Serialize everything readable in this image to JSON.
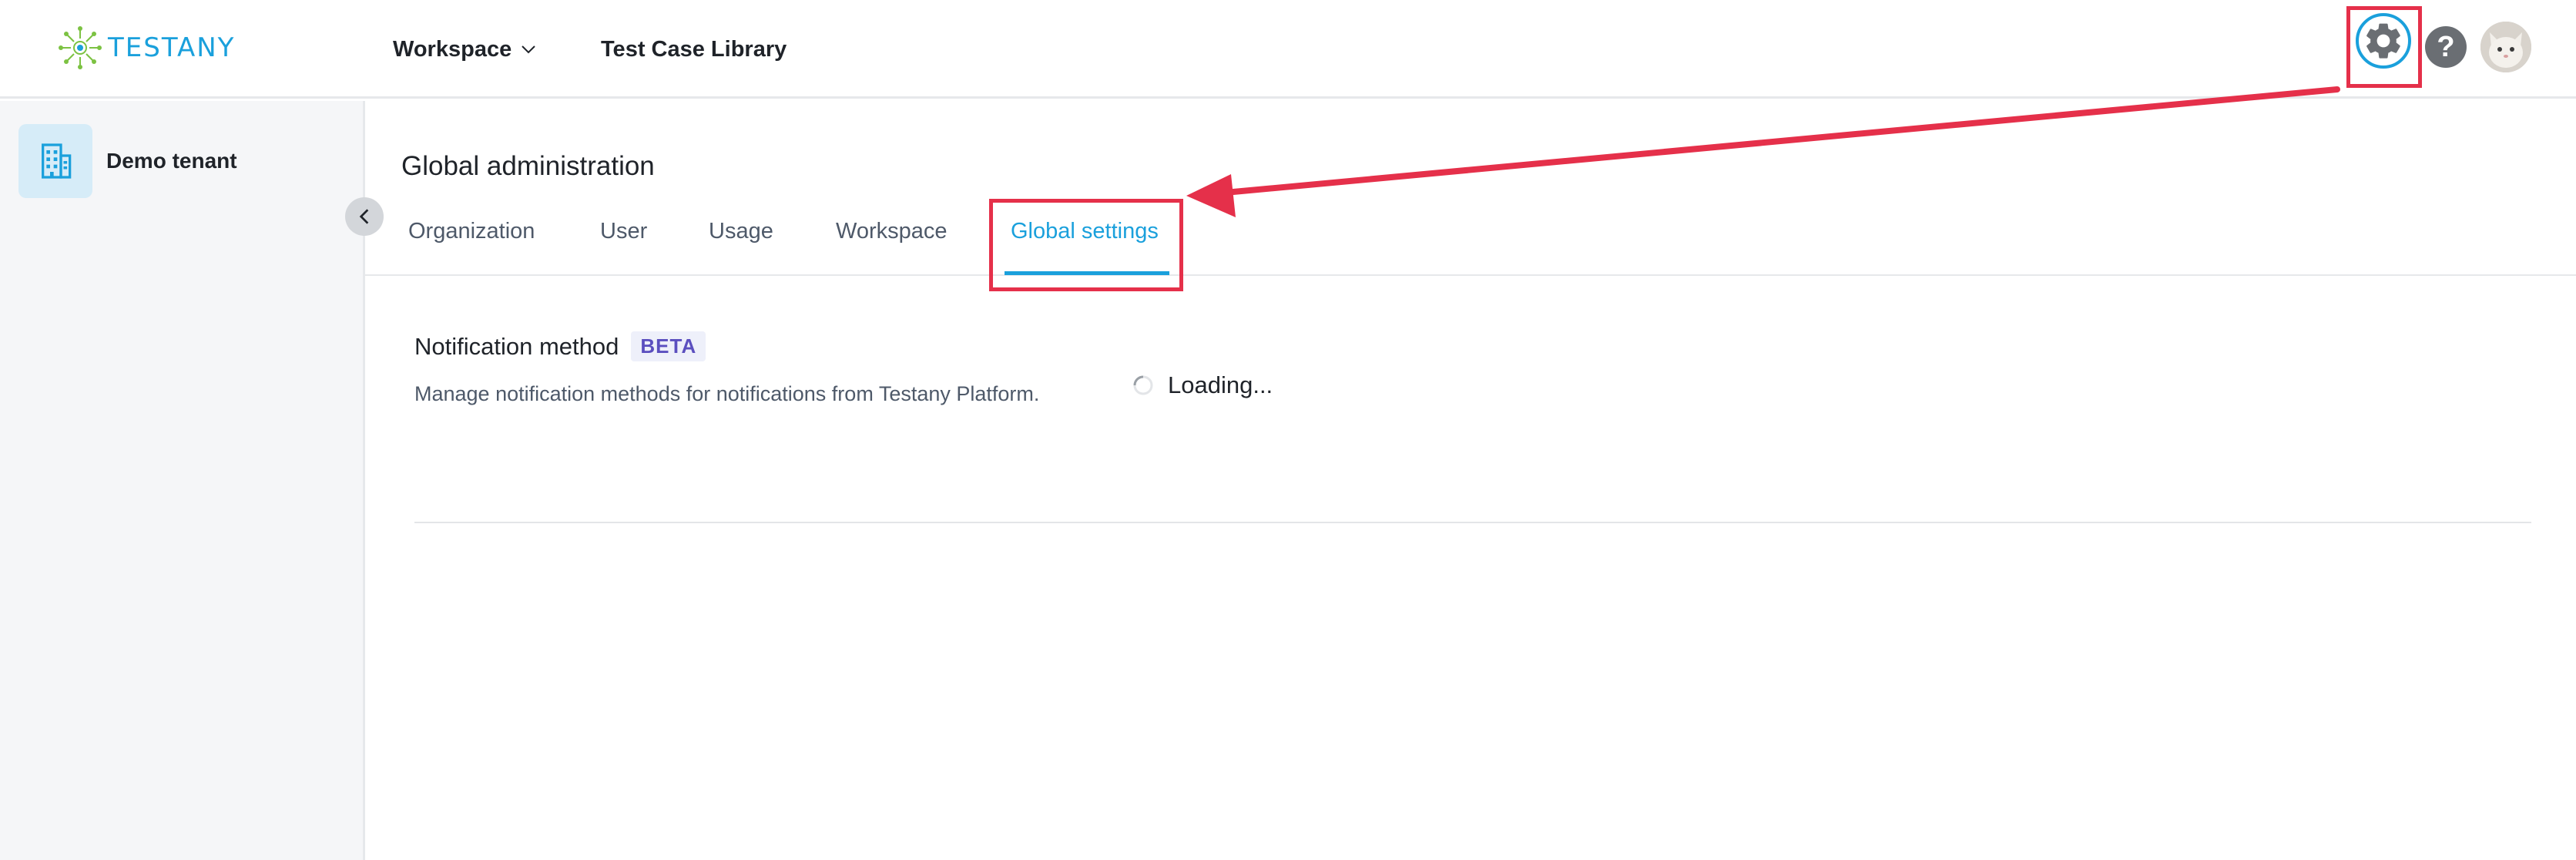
{
  "header": {
    "logo_text": "TESTANY",
    "nav": {
      "workspace_label": "Workspace",
      "library_label": "Test Case Library"
    },
    "icons": [
      "settings-gear-icon",
      "help-icon",
      "user-avatar"
    ]
  },
  "sidebar": {
    "tenant_name": "Demo tenant",
    "tenant_icon": "building-icon",
    "collapse_icon": "chevron-left-icon"
  },
  "main": {
    "title": "Global administration",
    "tabs": [
      {
        "label": "Organization",
        "active": false
      },
      {
        "label": "User",
        "active": false
      },
      {
        "label": "Usage",
        "active": false
      },
      {
        "label": "Workspace",
        "active": false
      },
      {
        "label": "Global settings",
        "active": true
      }
    ],
    "notification": {
      "title": "Notification method",
      "badge": "BETA",
      "description": "Manage notification methods for notifications from Testany Platform.",
      "loading_text": "Loading..."
    }
  },
  "colors": {
    "accent": "#1aa0dc",
    "highlight_annotation": "#e5304a",
    "beta_text": "#5b4fbf",
    "sidebar_bg": "#f5f6f8"
  }
}
